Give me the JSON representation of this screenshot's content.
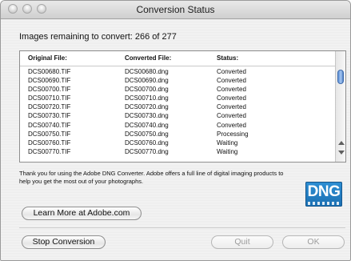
{
  "window": {
    "title": "Conversion Status"
  },
  "status": {
    "remaining_text": "Images remaining to convert: 266 of 277"
  },
  "table": {
    "headers": [
      "Original File:",
      "Converted File:",
      "Status:"
    ],
    "rows": [
      [
        "DCS00680.TIF",
        "DCS00680.dng",
        "Converted"
      ],
      [
        "DCS00690.TIF",
        "DCS00690.dng",
        "Converted"
      ],
      [
        "DCS00700.TIF",
        "DCS00700.dng",
        "Converted"
      ],
      [
        "DCS00710.TIF",
        "DCS00710.dng",
        "Converted"
      ],
      [
        "DCS00720.TIF",
        "DCS00720.dng",
        "Converted"
      ],
      [
        "DCS00730.TIF",
        "DCS00730.dng",
        "Converted"
      ],
      [
        "DCS00740.TIF",
        "DCS00740.dng",
        "Converted"
      ],
      [
        "DCS00750.TIF",
        "DCS00750.dng",
        "Processing"
      ],
      [
        "DCS00760.TIF",
        "DCS00760.dng",
        "Waiting"
      ],
      [
        "DCS00770.TIF",
        "DCS00770.dng",
        "Waiting"
      ]
    ]
  },
  "message": {
    "text": "Thank you for using the Adobe DNG Converter. Adobe offers a full line of digital imaging products to help you get the most out of your photographs."
  },
  "logo": {
    "text": "DNG",
    "color": "#1b6fb2"
  },
  "buttons": {
    "learn_more": "Learn More at Adobe.com",
    "stop": "Stop Conversion",
    "quit": "Quit",
    "ok": "OK"
  }
}
